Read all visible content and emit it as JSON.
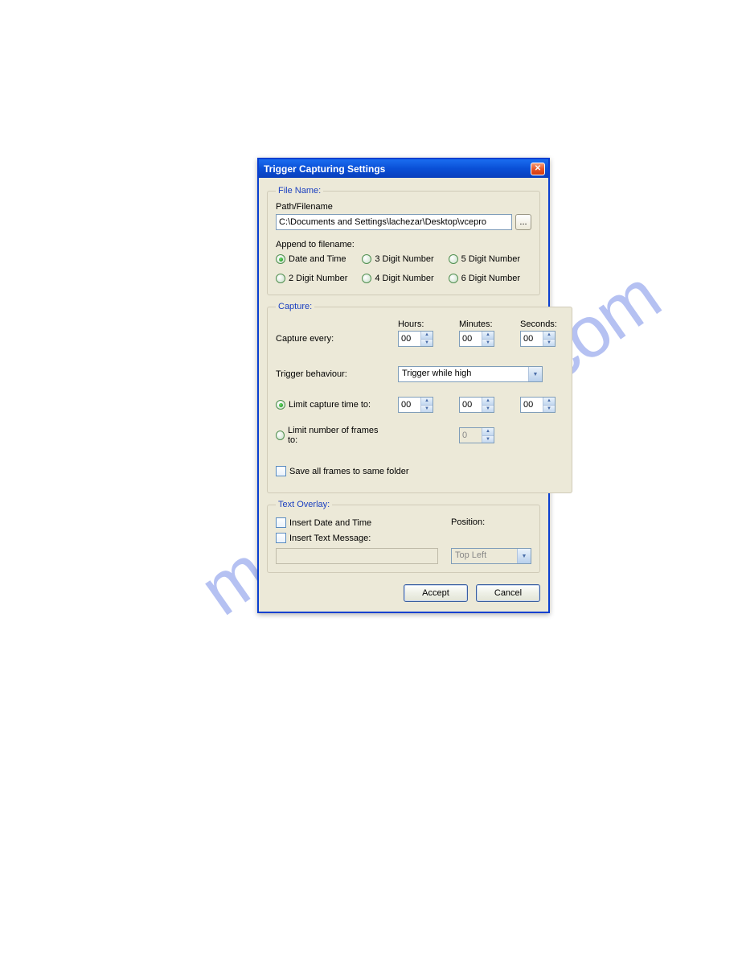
{
  "watermark": "manualshive.com",
  "dialog": {
    "title": "Trigger Capturing Settings"
  },
  "file_name": {
    "legend": "File Name:",
    "path_label": "Path/Filename",
    "path_value": "C:\\Documents and Settings\\lachezar\\Desktop\\vcepro",
    "browse": "...",
    "append_label": "Append to filename:",
    "radios": {
      "r0": "Date and Time",
      "r1": "3 Digit Number",
      "r2": "5 Digit Number",
      "r3": "2 Digit Number",
      "r4": "4 Digit Number",
      "r5": "6 Digit Number"
    },
    "selected": "r0"
  },
  "capture": {
    "legend": "Capture:",
    "hours_label": "Hours:",
    "minutes_label": "Minutes:",
    "seconds_label": "Seconds:",
    "capture_every_label": "Capture every:",
    "capture_every": {
      "hours": "00",
      "minutes": "00",
      "seconds": "00"
    },
    "trigger_label": "Trigger behaviour:",
    "trigger_value": "Trigger while high",
    "limit_time_label": "Limit capture time to:",
    "limit_time": {
      "hours": "00",
      "minutes": "00",
      "seconds": "00"
    },
    "limit_frames_label": "Limit number of frames to:",
    "limit_frames_value": "0",
    "limit_mode": "time",
    "save_folder_label": "Save all frames to same folder"
  },
  "overlay": {
    "legend": "Text Overlay:",
    "insert_date_label": "Insert Date and Time",
    "insert_msg_label": "Insert Text Message:",
    "position_label": "Position:",
    "position_value": "Top Left"
  },
  "buttons": {
    "accept": "Accept",
    "cancel": "Cancel"
  }
}
